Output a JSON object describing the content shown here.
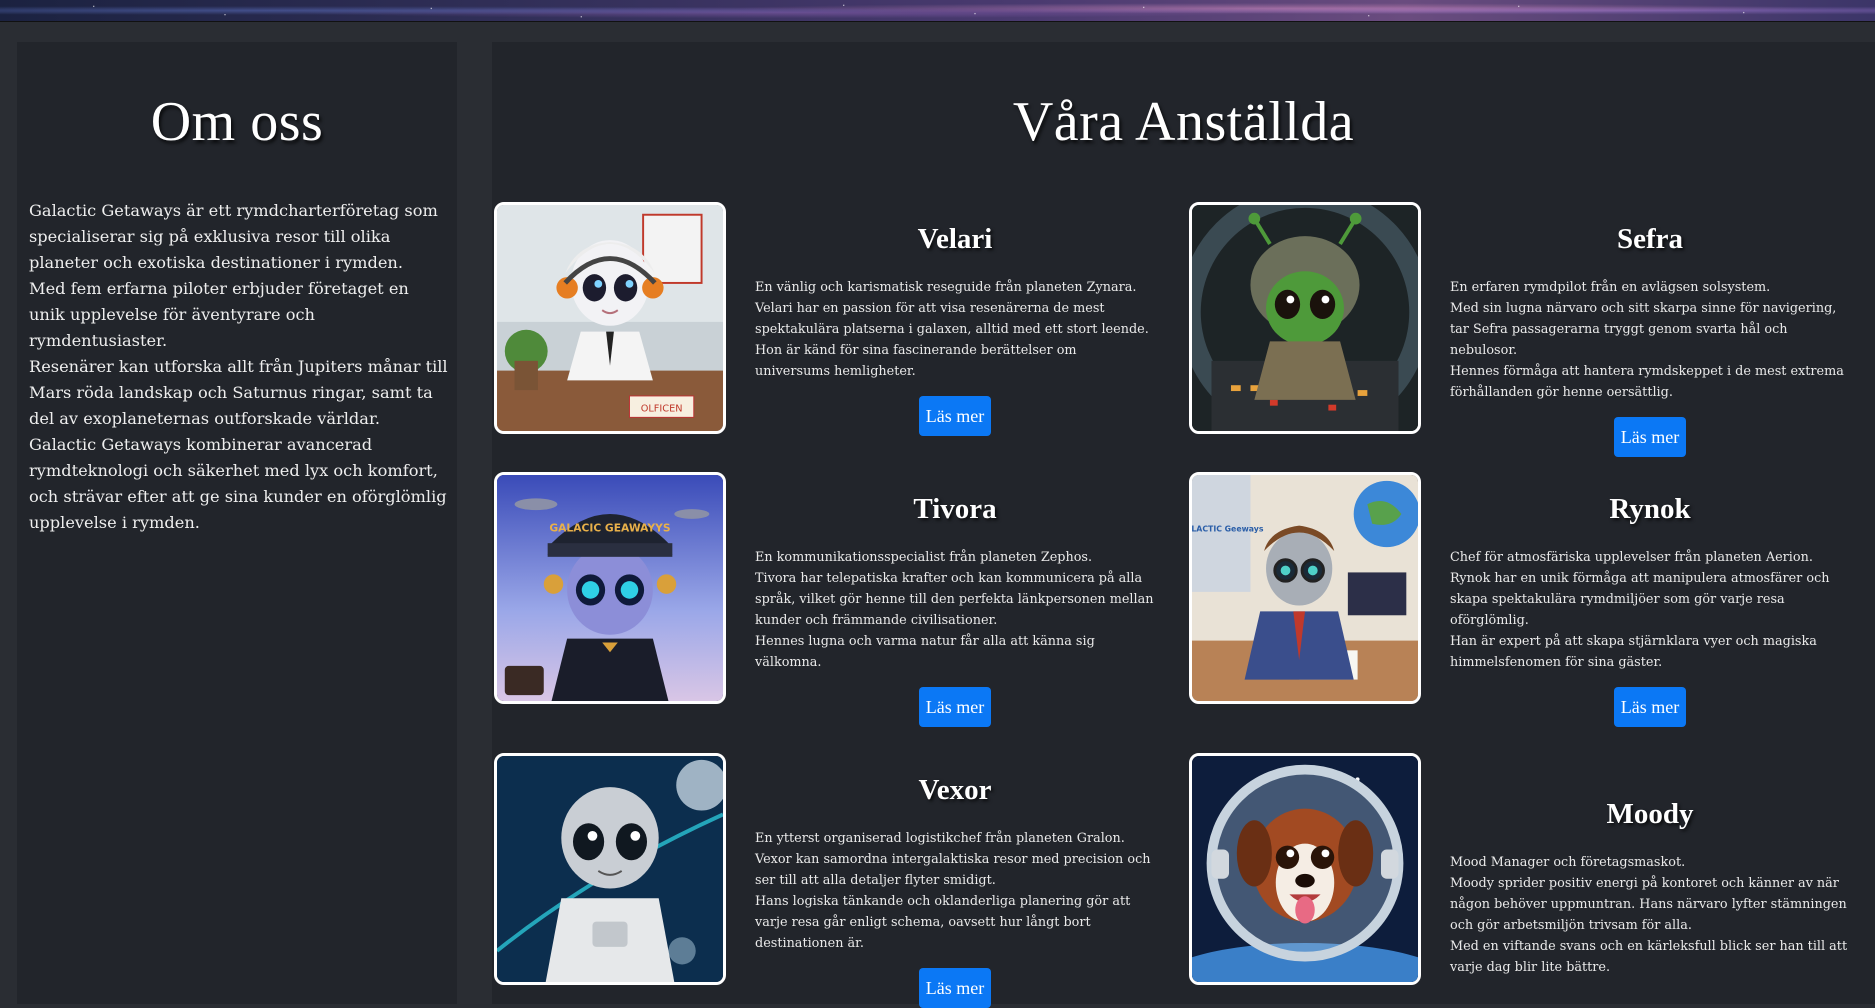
{
  "about": {
    "title": "Om oss",
    "paragraphs": [
      "Galactic Getaways är ett rymdcharterföretag som specialiserar sig på exklusiva resor till olika planeter och exotiska destinationer i rymden.",
      "Med fem erfarna piloter erbjuder företaget en unik upplevelse för äventyrare och rymdentusiaster.",
      "Resenärer kan utforska allt från Jupiters månar till Mars röda landskap och Saturnus ringar, samt ta del av exoplaneternas outforskade världar.",
      "Galactic Getaways kombinerar avancerad rymdteknologi och säkerhet med lyx och komfort, och strävar efter att ge sina kunder en oförglömlig upplevelse i rymden."
    ]
  },
  "team": {
    "title": "Våra Anställda",
    "read_more_label": "Läs mer",
    "members": [
      {
        "name": "Velari",
        "bio": [
          "En vänlig och karismatisk reseguide från planeten Zynara.",
          "Velari har en passion för att visa resenärerna de mest spektakulära platserna i galaxen, alltid med ett stort leende.",
          "Hon är känd för sina fascinerande berättelser om universums hemligheter."
        ],
        "nameplate_text": "OLFICEN"
      },
      {
        "name": "Sefra",
        "bio": [
          "En erfaren rymdpilot från en avlägsen solsystem.",
          "Med sin lugna närvaro och sitt skarpa sinne för navigering, tar Sefra passagerarna tryggt genom svarta hål och nebulosor.",
          "Hennes förmåga att hantera rymdskeppet i de mest extrema förhållanden gör henne oersättlig."
        ]
      },
      {
        "name": "Tivora",
        "bio": [
          "En kommunikationsspecialist från planeten Zephos.",
          "Tivora har telepatiska krafter och kan kommunicera på alla språk, vilket gör henne till den perfekta länkpersonen mellan kunder och främmande civilisationer.",
          "Hennes lugna och varma natur får alla att känna sig välkomna."
        ],
        "hat_text": "GALACIC GEAWAYYS"
      },
      {
        "name": "Rynok",
        "bio": [
          "Chef för atmosfäriska upplevelser från planeten Aerion.",
          "Rynok har en unik förmåga att manipulera atmosfärer och skapa spektakulära rymdmiljöer som gör varje resa oförglömlig.",
          "Han är expert på att skapa stjärnklara vyer och magiska himmelsfenomen för sina gäster."
        ],
        "poster_text": "GALACTIC Geeways"
      },
      {
        "name": "Vexor",
        "bio": [
          "En ytterst organiserad logistikchef från planeten Gralon.",
          "Vexor kan samordna intergalaktiska resor med precision och ser till att alla detaljer flyter smidigt.",
          "Hans logiska tänkande och oklanderliga planering gör att varje resa går enligt schema, oavsett hur långt bort destinationen är."
        ]
      },
      {
        "name": "Moody",
        "bio": [
          "Mood Manager och företagsmaskot.",
          "Moody sprider positiv energi på kontoret och känner av när någon behöver uppmuntran. Hans närvaro lyfter stämningen och gör arbetsmiljön trivsam för alla.",
          "Med en viftande svans och en kärleksfull blick ser han till att varje dag blir lite bättre."
        ]
      }
    ]
  }
}
